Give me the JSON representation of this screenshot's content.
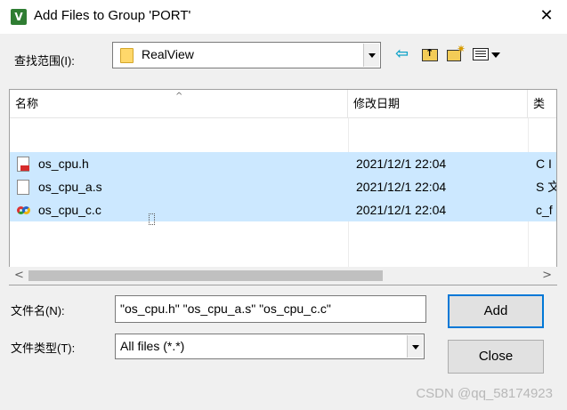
{
  "window": {
    "title": "Add Files to Group 'PORT'",
    "close_glyph": "✕"
  },
  "lookin": {
    "label": "查找范围(I):",
    "value": "RealView"
  },
  "toolbar": {
    "back_glyph": "⇦"
  },
  "columns": [
    "名称",
    "修改日期",
    "类"
  ],
  "files": [
    {
      "name": "os_cpu.h",
      "modified": "2021/12/1 22:04",
      "type": "C I",
      "icon": "header-file-icon"
    },
    {
      "name": "os_cpu_a.s",
      "modified": "2021/12/1 22:04",
      "type": "S 文",
      "icon": "text-file-icon"
    },
    {
      "name": "os_cpu_c.c",
      "modified": "2021/12/1 22:04",
      "type": "c_f",
      "icon": "c-source-file-icon"
    }
  ],
  "filename": {
    "label": "文件名(N):",
    "value": "\"os_cpu.h\" \"os_cpu_a.s\" \"os_cpu_c.c\""
  },
  "filetype": {
    "label": "文件类型(T):",
    "value": "All files (*.*)"
  },
  "buttons": {
    "add": "Add",
    "close": "Close"
  },
  "scroll": {
    "left": "<",
    "right": ">"
  },
  "watermark": "CSDN @qq_58174923"
}
